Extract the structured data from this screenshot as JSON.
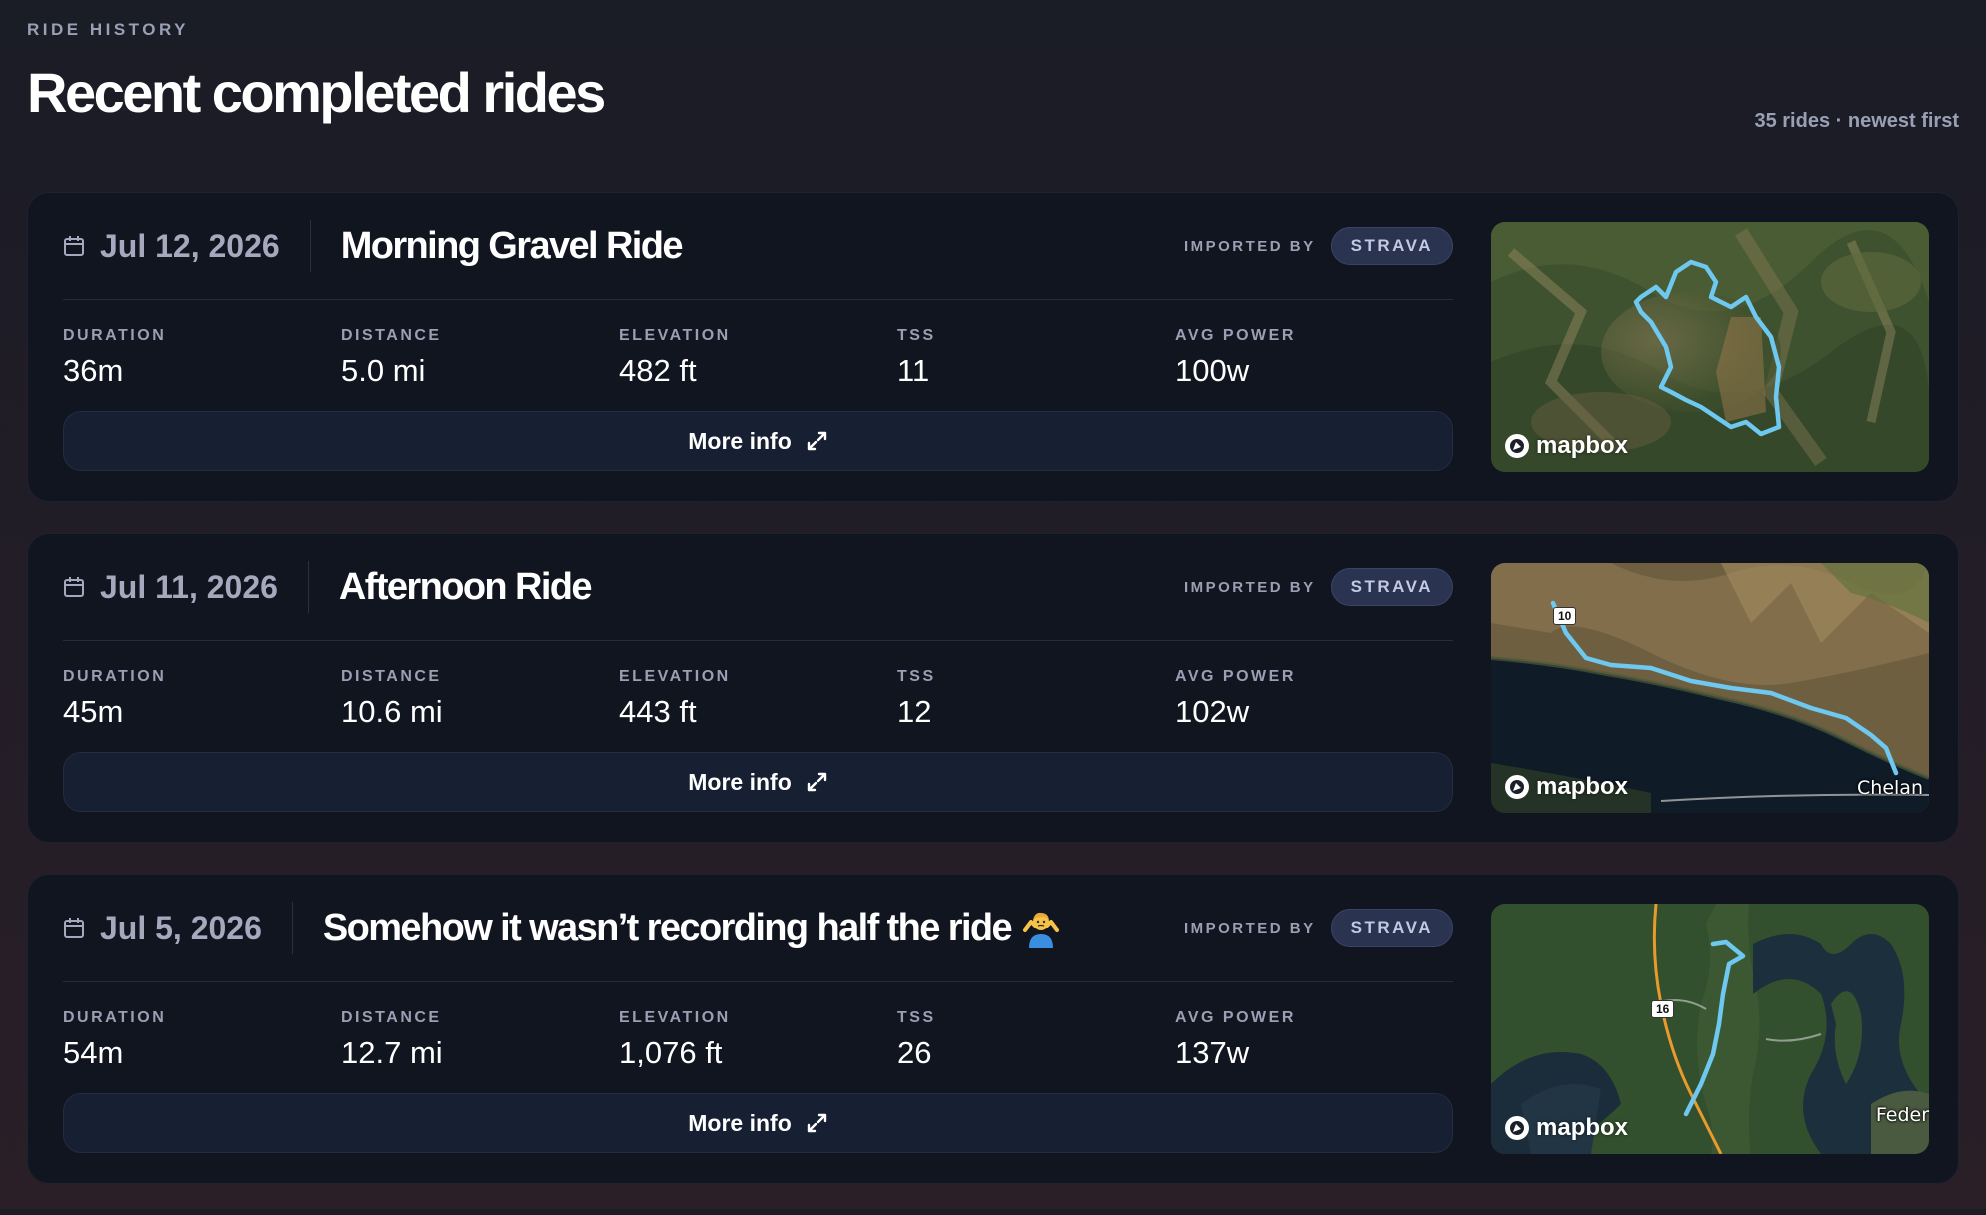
{
  "header": {
    "eyebrow": "RIDE HISTORY",
    "title": "Recent completed rides",
    "ride_count": "35 rides · newest first"
  },
  "labels": {
    "imported_by": "IMPORTED BY",
    "more_info": "More info",
    "map_attribution": "mapbox"
  },
  "metric_labels": {
    "duration": "DURATION",
    "distance": "DISTANCE",
    "elevation": "ELEVATION",
    "tss": "TSS",
    "avg_power": "AVG POWER"
  },
  "colors": {
    "route": "#6ec8ef",
    "badge_bg": "#2a3350",
    "card_bg": "#111520"
  },
  "rides": [
    {
      "date": "Jul 12, 2026",
      "title": "Morning Gravel Ride",
      "source": "STRAVA",
      "duration": "36m",
      "distance": "5.0 mi",
      "elevation": "482 ft",
      "tss": "11",
      "avg_power": "100w",
      "map_place": ""
    },
    {
      "date": "Jul 11, 2026",
      "title": "Afternoon Ride",
      "source": "STRAVA",
      "duration": "45m",
      "distance": "10.6 mi",
      "elevation": "443 ft",
      "tss": "12",
      "avg_power": "102w",
      "map_place": "Chelan",
      "map_shield": "10"
    },
    {
      "date": "Jul 5, 2026",
      "title": "Somehow it wasn’t recording half the ride",
      "title_emoji": "person-shrugging-emoji",
      "source": "STRAVA",
      "duration": "54m",
      "distance": "12.7 mi",
      "elevation": "1,076 ft",
      "tss": "26",
      "avg_power": "137w",
      "map_place": "Feder",
      "map_shield": "16"
    }
  ]
}
